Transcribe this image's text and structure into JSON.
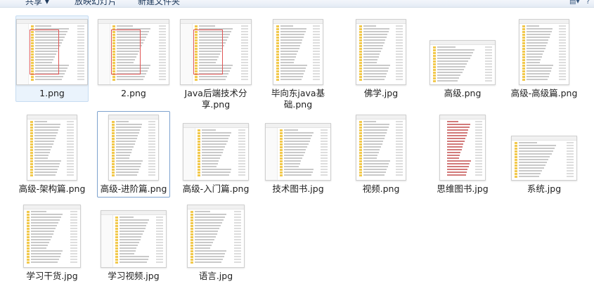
{
  "toolbar": {
    "share_label": "共享",
    "share_chevron": "▾",
    "slideshow_label": "放映幻灯片",
    "new_folder_label": "新建文件夹",
    "view_icon": "view-options-icon",
    "help_icon": "help-icon"
  },
  "files": [
    {
      "name": "1.png",
      "thumb": "explorer-window-red-box",
      "state": "selected"
    },
    {
      "name": "2.png",
      "thumb": "explorer-window-red-box",
      "state": "normal"
    },
    {
      "name": "Java后端技术分享.png",
      "thumb": "explorer-window-red-box",
      "state": "normal"
    },
    {
      "name": "毕向东java基础.png",
      "thumb": "folder-list-tall",
      "state": "normal"
    },
    {
      "name": "佛学.jpg",
      "thumb": "folder-list-tall",
      "state": "normal"
    },
    {
      "name": "高级.png",
      "thumb": "folder-list-short",
      "state": "normal"
    },
    {
      "name": "高级-高级篇.png",
      "thumb": "folder-list-tall",
      "state": "normal"
    },
    {
      "name": "高级-架构篇.png",
      "thumb": "folder-list-tall",
      "state": "normal"
    },
    {
      "name": "高级-进阶篇.png",
      "thumb": "folder-list-tall",
      "state": "hover"
    },
    {
      "name": "高级-入门篇.png",
      "thumb": "explorer-window",
      "state": "normal"
    },
    {
      "name": "技术图书.jpg",
      "thumb": "explorer-window",
      "state": "normal"
    },
    {
      "name": "视频.png",
      "thumb": "folder-list-tall",
      "state": "normal"
    },
    {
      "name": "思维图书.jpg",
      "thumb": "red-link-list",
      "state": "normal"
    },
    {
      "name": "系统.jpg",
      "thumb": "folder-list-short",
      "state": "normal"
    },
    {
      "name": "学习干货.jpg",
      "thumb": "folder-list-medium",
      "state": "normal"
    },
    {
      "name": "学习视频.jpg",
      "thumb": "explorer-window",
      "state": "normal"
    },
    {
      "name": "语言.jpg",
      "thumb": "folder-list-medium",
      "state": "normal"
    }
  ]
}
